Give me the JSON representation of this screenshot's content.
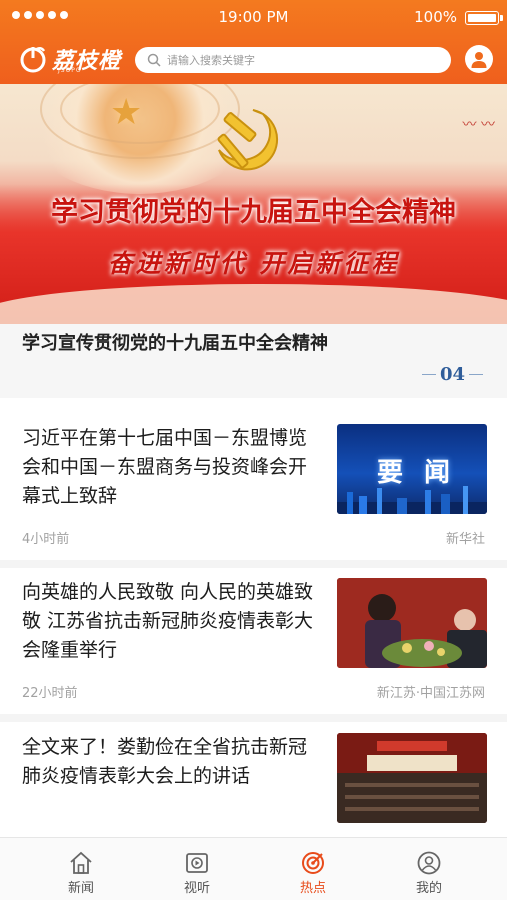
{
  "status_bar": {
    "time": "19:00 PM",
    "battery": "100%"
  },
  "header": {
    "logo_text": "荔枝橙",
    "logo_sub": "JSOPO",
    "search_placeholder": "请输入搜索关键字"
  },
  "banner": {
    "title": "学习贯彻党的十九届五中全会精神",
    "subtitle": "奋进新时代 开启新征程",
    "caption": "学习宣传贯彻党的十九届五中全会精神",
    "page_number": "04"
  },
  "news": [
    {
      "title": "习近平在第十七届中国－东盟博览会和中国－东盟商务与投资峰会开幕式上致辞",
      "time": "4小时前",
      "source": "新华社",
      "thumb_label": "要 闻"
    },
    {
      "title": "向英雄的人民致敬 向人民的英雄致敬 江苏省抗击新冠肺炎疫情表彰大会隆重举行",
      "time": "22小时前",
      "source": "新江苏·中国江苏网"
    },
    {
      "title": "全文来了！娄勤俭在全省抗击新冠肺炎疫情表彰大会上的讲话"
    }
  ],
  "tabbar": {
    "items": [
      {
        "label": "新闻",
        "icon": "home-icon"
      },
      {
        "label": "视听",
        "icon": "video-icon"
      },
      {
        "label": "热点",
        "icon": "target-icon",
        "active": true
      },
      {
        "label": "我的",
        "icon": "user-icon"
      }
    ]
  },
  "colors": {
    "brand": "#ef5f1d",
    "active_tab": "#e84b1a"
  }
}
